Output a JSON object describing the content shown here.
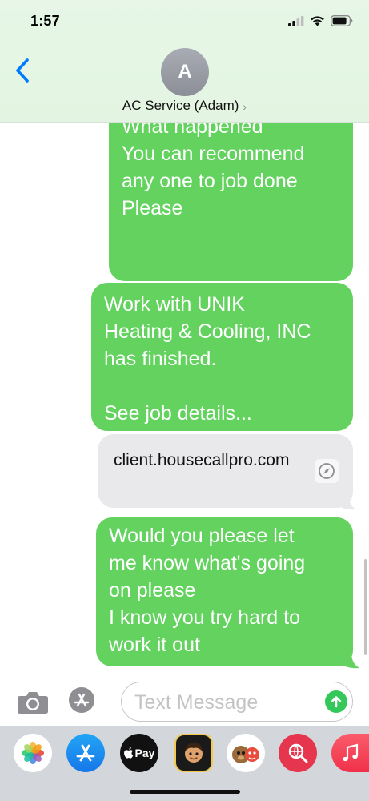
{
  "status_bar": {
    "time": "1:57",
    "icons": [
      "signal-icon",
      "wifi-icon",
      "battery-icon"
    ]
  },
  "header": {
    "back_icon": "chevron-left-icon",
    "avatar_initial": "A",
    "contact_name": "AC Service (Adam)",
    "chevron": "›"
  },
  "messages": [
    {
      "type": "sent",
      "text": "What happened\nYou can recommend\nany one to job done\nPlease"
    },
    {
      "type": "sent",
      "text": "Work with UNIK\nHeating & Cooling, INC\nhas finished.\n\nSee job details..."
    },
    {
      "type": "link",
      "text": "client.housecallpro.com",
      "icon": "compass-icon"
    },
    {
      "type": "sent",
      "text": "Would you please let\nme know what's going\non please\nI know you try hard to\nwork it out"
    }
  ],
  "input_bar": {
    "camera_icon": "camera-icon",
    "apps_icon": "app-store-icon",
    "placeholder": "Text Message",
    "send_icon": "send-arrow-icon"
  },
  "app_drawer": {
    "apps": [
      {
        "name": "Photos",
        "icon": "photos-icon"
      },
      {
        "name": "App Store",
        "icon": "app-store-icon"
      },
      {
        "name": "Apple Pay",
        "label": "Pay",
        "icon": "apple-pay-icon"
      },
      {
        "name": "Memoji",
        "icon": "memoji-icon"
      },
      {
        "name": "Animoji",
        "icon": "animoji-icon"
      },
      {
        "name": "Images Search",
        "icon": "globe-search-icon"
      },
      {
        "name": "Music",
        "icon": "music-icon"
      }
    ]
  },
  "colors": {
    "sent_bubble": "#63d25f",
    "header_bg": "#e7f6e6",
    "link_card": "#e9e9eb",
    "ios_blue": "#007aff",
    "send_green": "#34c759"
  }
}
